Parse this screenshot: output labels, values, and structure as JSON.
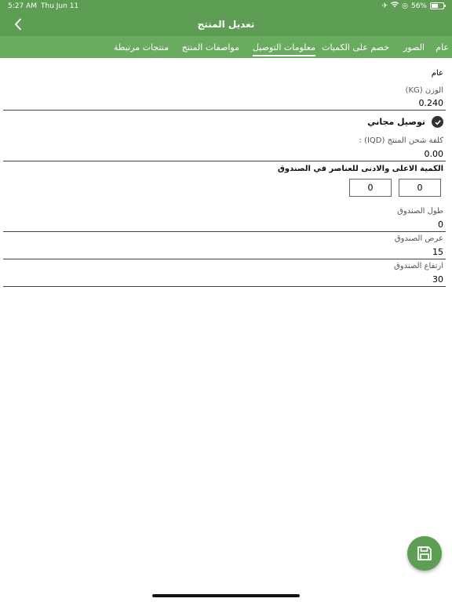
{
  "status_bar": {
    "time": "5:27 AM",
    "date": "Thu Jun 11",
    "battery_percent": "56%",
    "battery_level": 0.56
  },
  "nav": {
    "title": "تعديل المنتج"
  },
  "tabs": [
    {
      "label": "عام"
    },
    {
      "label": "الصور"
    },
    {
      "label": "خصم على الكميات"
    },
    {
      "label": "معلومات التوصيل",
      "active": true
    },
    {
      "label": "مواصفات المنتج"
    },
    {
      "label": "منتجات مرتبطة"
    }
  ],
  "form": {
    "section_title": "عام",
    "weight": {
      "label": "الوزن (KG)",
      "value": "0.240"
    },
    "free_delivery": {
      "label": "توصيل مجاني",
      "checked": true
    },
    "shipping_cost": {
      "label": "كلفة شحن المنتج (IQD) :",
      "value": "0.00"
    },
    "box_qty": {
      "label": "الكمية الاعلى والادنى للعناصر في الصندوق",
      "max": "0",
      "min": "0"
    },
    "box_length": {
      "label": "طول الصندوق",
      "value": "0"
    },
    "box_width": {
      "label": "عرض الصندوق",
      "value": "15"
    },
    "box_height": {
      "label": "ارتفاع الصندوق",
      "value": "30"
    }
  },
  "icons": {
    "back": "chevron-left-icon",
    "save": "floppy-disk-icon",
    "check": "checkmark-icon"
  },
  "colors": {
    "primary": "#5e9e54",
    "tab_bar": "#6aac5f"
  }
}
